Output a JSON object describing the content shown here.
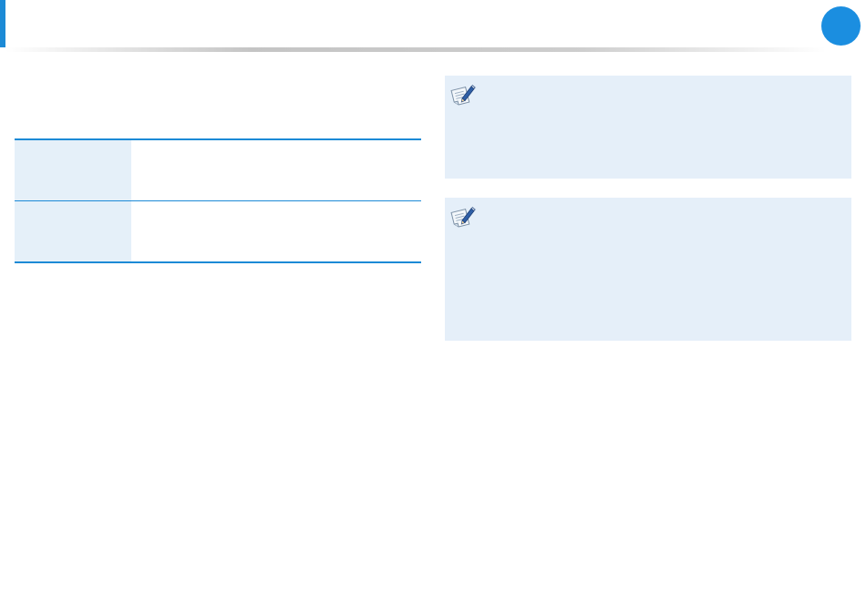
{
  "header": {
    "title": "",
    "page_number": ""
  },
  "spec_table": {
    "rows": [
      {
        "label": "",
        "value": ""
      },
      {
        "label": "",
        "value": ""
      }
    ]
  },
  "notes": [
    {
      "icon": "note-pencil-icon",
      "text": ""
    },
    {
      "icon": "note-pencil-icon",
      "text": ""
    }
  ],
  "colors": {
    "accent": "#1c8ad6",
    "note_background": "#e5eff9",
    "label_cell_background": "#e5f0f9"
  }
}
